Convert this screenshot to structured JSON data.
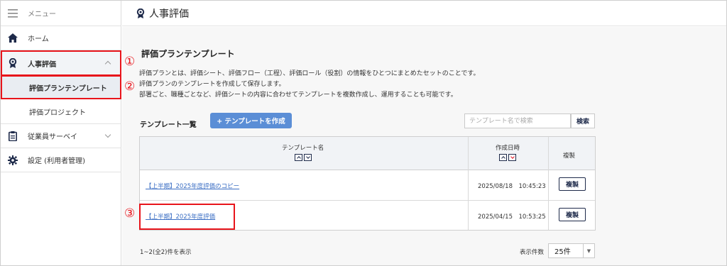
{
  "sidebar": {
    "menu_label": "メニュー",
    "items": [
      {
        "label": "ホーム"
      },
      {
        "label": "人事評価"
      },
      {
        "label": "評価プランテンプレート"
      },
      {
        "label": "評価プロジェクト"
      },
      {
        "label": "従業員サーベイ"
      },
      {
        "label": "設定 (利用者管理)"
      }
    ]
  },
  "header": {
    "title": "人事評価"
  },
  "main": {
    "heading": "評価プランテンプレート",
    "description": [
      "評価プランとは、評価シート、評価フロー（工程）、評価ロール（役割）の情報をひとつにまとめたセットのことです。",
      "評価プランのテンプレートを作成して保存します。",
      "部署ごと、職種ごとなど、評価シートの内容に合わせてテンプレートを複数作成し、運用することも可能です。"
    ],
    "list_label": "テンプレート一覧",
    "create_button": "+ テンプレートを作成",
    "search_placeholder": "テンプレート名で検索",
    "search_button": "検索",
    "table": {
      "columns": [
        "テンプレート名",
        "作成日時",
        "複製"
      ],
      "rows": [
        {
          "name": "【上半期】2025年度評価のコピー",
          "created": "2025/08/18　10:45:23",
          "copy": "複製"
        },
        {
          "name": "【上半期】2025年度評価",
          "created": "2025/04/15　10:53:25",
          "copy": "複製"
        }
      ]
    },
    "footer": {
      "count_text": "1~2(全2)件を表示",
      "per_page_label": "表示件数",
      "per_page_value": "25件"
    }
  },
  "annotations": {
    "callout_1": "①",
    "callout_2": "②",
    "callout_3": "③",
    "highlight_color": "#e8141b"
  },
  "colors": {
    "accent": "#5b8ed6",
    "navy": "#1e2a4a",
    "link": "#3c6fc4"
  }
}
